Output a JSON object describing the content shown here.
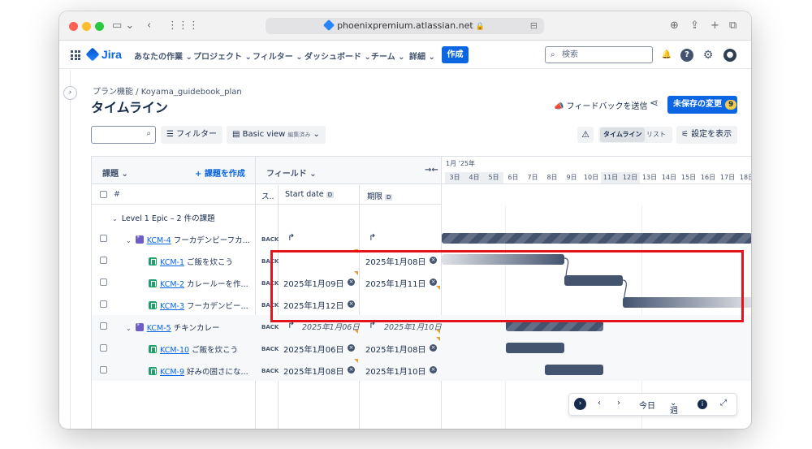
{
  "browser": {
    "url": "phoenixpremium.atlassian.net"
  },
  "nav": {
    "logo": "Jira",
    "items": [
      "あなたの作業",
      "プロジェクト",
      "フィルター",
      "ダッシュボード",
      "チーム",
      "詳細"
    ],
    "create": "作成",
    "search_placeholder": "検索"
  },
  "page": {
    "breadcrumb": "プラン機能  /  Koyama_guidebook_plan",
    "title": "タイムライン",
    "feedback": "フィードバックを送信",
    "unsaved": "未保存の変更",
    "unsaved_count": "9"
  },
  "toolbar": {
    "filter": "フィルター",
    "view": "Basic view",
    "view_tag": "編集済み",
    "view_timeline": "タイムライン",
    "view_list": "リスト",
    "settings": "設定を表示"
  },
  "table": {
    "issues_header": "課題",
    "create_issue": "課題を作成",
    "fields_header": "フィールド",
    "hash": "#",
    "status_col": "ス..",
    "start_col": "Start date",
    "due_col": "期限",
    "month": "1月 '25年",
    "days": [
      "3日",
      "4日",
      "5日",
      "6日",
      "7日",
      "8日",
      "9日",
      "10日",
      "11日",
      "12日",
      "13日",
      "14日",
      "15日",
      "16日",
      "17日",
      "18日"
    ],
    "group": "Level 1 Epic – 2 件の課題",
    "rows": [
      {
        "key": "KCM-4",
        "title": "フーカデンビーフカ...",
        "status": "BACK",
        "start": "",
        "due": "",
        "type": "epic"
      },
      {
        "key": "KCM-1",
        "title": "ご飯を炊こう",
        "status": "BACK",
        "start": "",
        "due": "2025年1月08日",
        "type": "story"
      },
      {
        "key": "KCM-2",
        "title": "カレールーを作...",
        "status": "BACK",
        "start": "2025年1月09日",
        "due": "2025年1月11日",
        "type": "story"
      },
      {
        "key": "KCM-3",
        "title": "フーカデンビー...",
        "status": "BACK",
        "start": "2025年1月12日",
        "due": "",
        "type": "story"
      },
      {
        "key": "KCM-5",
        "title": "チキンカレー",
        "status": "BACK",
        "start": "2025年1月06日",
        "due": "2025年1月10日",
        "type": "epic"
      },
      {
        "key": "KCM-10",
        "title": "ご飯を炊こう",
        "status": "BACK",
        "start": "2025年1月06日",
        "due": "2025年1月08日",
        "type": "story"
      },
      {
        "key": "KCM-9",
        "title": "好みの固さにな...",
        "status": "BACK",
        "start": "2025年1月08日",
        "due": "2025年1月10日",
        "type": "story"
      }
    ]
  },
  "bottom": {
    "today": "今日",
    "week": "週"
  }
}
